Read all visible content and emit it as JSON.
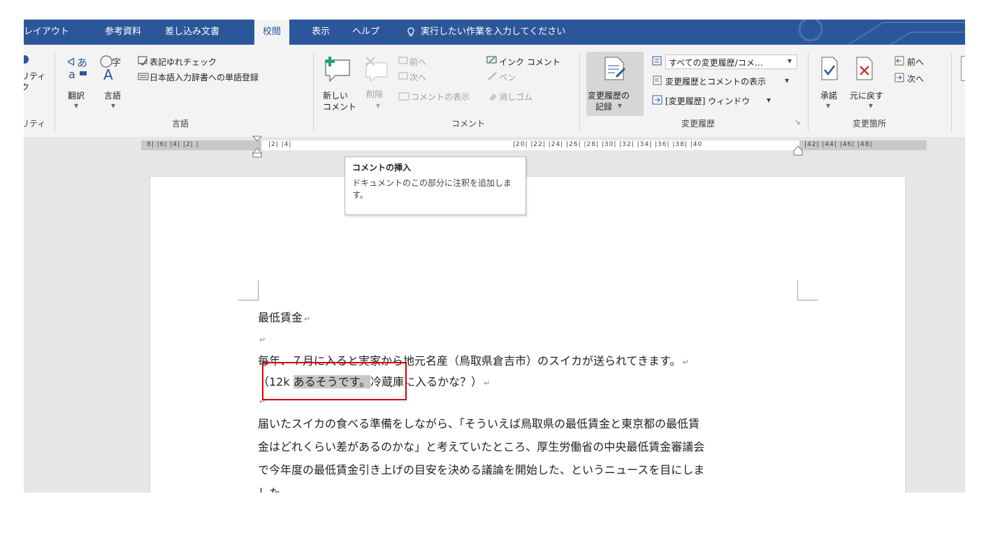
{
  "tabs": [
    {
      "label": "レイアウト",
      "active": false
    },
    {
      "label": "参考資料",
      "active": false
    },
    {
      "label": "差し込み文書",
      "active": false
    },
    {
      "label": "校閲",
      "active": true
    },
    {
      "label": "表示",
      "active": false
    },
    {
      "label": "ヘルプ",
      "active": false
    }
  ],
  "tell_me": "実行したい作業を入力してください",
  "ribbon": {
    "accessibility": {
      "line1": "リティ",
      "line2": "ク",
      "group": "リティ"
    },
    "language": {
      "translate": "翻訳",
      "language": "言語",
      "spelling_check": "表記ゆれチェック",
      "dictionary": "日本語入力辞書への単語登録",
      "group": "言語"
    },
    "comments": {
      "new_line1": "新しい",
      "new_line2": "コメント",
      "delete": "削除",
      "previous": "前へ",
      "next": "次へ",
      "show_comments": "コメントの表示",
      "ink_comment": "インク コメント",
      "pen": "ペン",
      "eraser": "消しゴム",
      "group": "コメント"
    },
    "tracking": {
      "track_line1": "変更履歴の",
      "track_line2": "記録",
      "markup_select": "すべての変更履歴/コメ…",
      "show_markup": "変更履歴とコメントの表示",
      "reviewing_pane": "[変更履歴] ウィンドウ",
      "group": "変更履歴"
    },
    "changes": {
      "accept": "承諾",
      "reject": "元に戻す",
      "previous": "前へ",
      "next": "次へ",
      "group": "変更箇所"
    }
  },
  "ruler": {
    "left_numbers": "8| |6| |4| |2| |",
    "mid_numbers": "|2| |4|",
    "right_numbers": "|20| |22| |24| |26| |28| |30| |32| |34| |36| |38| |40",
    "far_numbers": "|42| |44| |46| |48|"
  },
  "tooltip": {
    "title": "コメントの挿入",
    "body": "ドキュメントのこの部分に注釈を追加します。"
  },
  "document": {
    "title": "最低賃金",
    "line1": "毎年、７月に入ると実家から地元名産（鳥取県倉吉市）のスイカが送られてきます。",
    "line2_before": "（12k ",
    "line2_selected": "あるそうです。",
    "line2_after": "冷蔵庫に入るかな？）",
    "para2_line1": "届いたスイカの食べる準備をしながら、「そういえば鳥取県の最低賃金と東京都の最低賃",
    "para2_line2": "金はどれくらい差があるのかな」と考えていたところ、厚生労働省の中央最低賃金審議会",
    "para2_line3": "で今年度の最低賃金引き上げの目安を決める議論を開始した、というニュースを目にしま",
    "para2_line4": "した。"
  },
  "colors": {
    "accent": "#2b579a",
    "highlight_box": "#d40000",
    "selection": "#c6c6c6"
  }
}
